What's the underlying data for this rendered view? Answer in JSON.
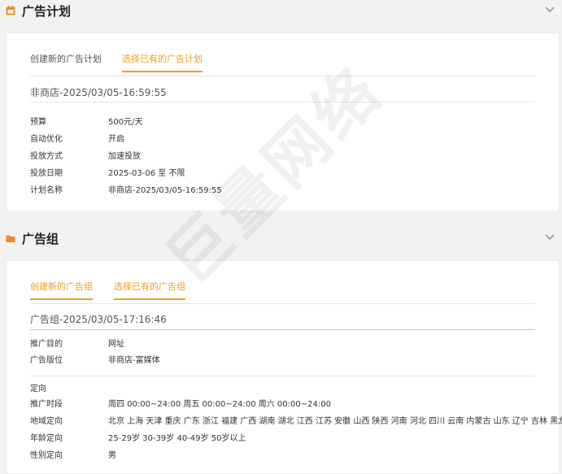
{
  "plan": {
    "title": "广告计划",
    "tabs": [
      "创建新的广告计划",
      "选择已有的广告计划"
    ],
    "selected_name": "非商店-2025/03/05-16:59:55",
    "fields": [
      {
        "label": "预算",
        "value": "500元/天"
      },
      {
        "label": "自动优化",
        "value": "开启"
      },
      {
        "label": "投放方式",
        "value": "加速投放"
      },
      {
        "label": "投放日期",
        "value": "2025-03-06 至 不限"
      },
      {
        "label": "计划名称",
        "value": "非商店-2025/03/05-16:59:55"
      }
    ]
  },
  "group": {
    "title": "广告组",
    "tabs": [
      "创建新的广告组",
      "选择已有的广告组"
    ],
    "selected_name": "广告组-2025/03/05-17:16:46",
    "fields": [
      {
        "label": "推广目的",
        "value": "网址"
      },
      {
        "label": "广告版位",
        "value": "非商店-富媒体"
      }
    ],
    "targeting_title": "定向",
    "targeting": [
      {
        "label": "推广时段",
        "value": "周四 00:00~24:00 周五 00:00~24:00 周六 00:00~24:00"
      },
      {
        "label": "地域定向",
        "value": "北京 上海 天津 重庆 广东 浙江 福建 广西 湖南 湖北 江西 江苏 安徽 山西 陕西 河南 河北 四川 云南 内蒙古 山东 辽宁 吉林 黑龙江"
      },
      {
        "label": "年龄定向",
        "value": "25-29岁 30-39岁 40-49岁 50岁以上"
      },
      {
        "label": "性别定向",
        "value": "男"
      }
    ]
  },
  "watermark": "巨量网络",
  "colors": {
    "accent": "#f0a019",
    "icon": "#f08a1c"
  }
}
